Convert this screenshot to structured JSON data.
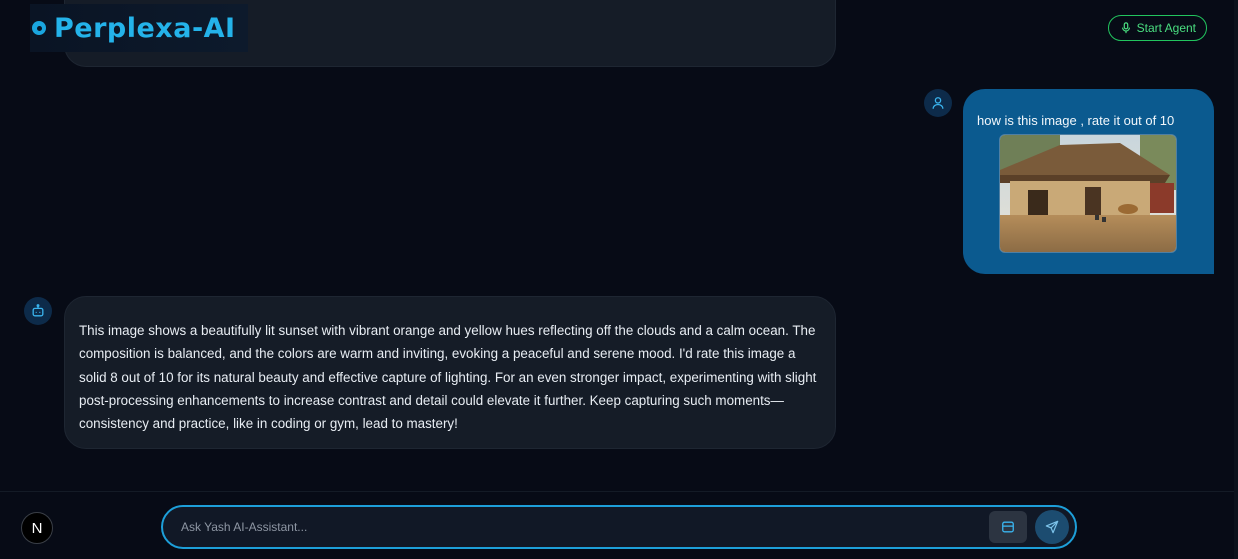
{
  "header": {
    "brand": "Perplexa-AI",
    "start_agent_label": "Start Agent"
  },
  "messages": {
    "user": {
      "text": "how is this image , rate it out of 10",
      "image_icon": "photo-thumbnail"
    },
    "bot": {
      "text": "This image shows a beautifully lit sunset with vibrant orange and yellow hues reflecting off the clouds and a calm ocean. The composition is balanced, and the colors are warm and inviting, evoking a peaceful and serene mood. I'd rate this image a solid 8 out of 10 for its natural beauty and effective capture of lighting. For an even stronger impact, experimenting with slight post-processing enhancements to increase contrast and detail could elevate it further. Keep capturing such moments—consistency and practice, like in coding or gym, lead to mastery!"
    }
  },
  "footer": {
    "avatar_letter": "N",
    "input_placeholder": "Ask Yash AI-Assistant...",
    "input_value": ""
  },
  "colors": {
    "background": "#070b16",
    "brand": "#24b3ea",
    "user_bubble": "#0b5a8f",
    "bot_bubble": "#151c27",
    "agent_green": "#22c55e",
    "input_border": "#1d9fd9"
  }
}
